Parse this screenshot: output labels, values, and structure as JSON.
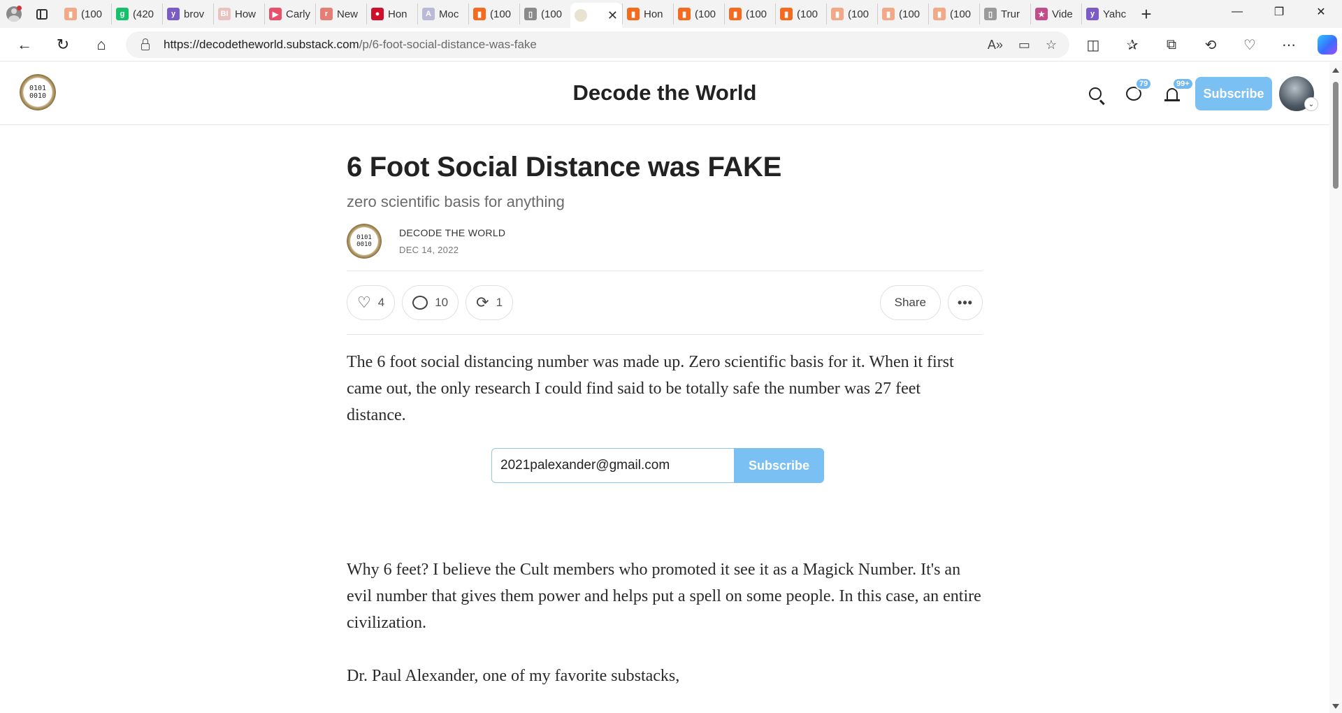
{
  "browser": {
    "tabs": [
      {
        "title": "(100",
        "color": "#f2a988",
        "glyph": "▮"
      },
      {
        "title": "(420",
        "color": "#15c26b",
        "glyph": "g"
      },
      {
        "title": "brov",
        "color": "#7b5cc7",
        "glyph": "y"
      },
      {
        "title": "How",
        "color": "#e8c4c0",
        "glyph": "BI"
      },
      {
        "title": "Carly",
        "color": "#e9506a",
        "glyph": "▶"
      },
      {
        "title": "New",
        "color": "#e57f76",
        "glyph": "r"
      },
      {
        "title": "Hon",
        "color": "#d0102a",
        "glyph": "●"
      },
      {
        "title": "Moc",
        "color": "#b9b9d8",
        "glyph": "A"
      },
      {
        "title": "(100",
        "color": "#f56a1f",
        "glyph": "▮"
      },
      {
        "title": "(100",
        "color": "#8a8a8a",
        "glyph": "▯"
      }
    ],
    "active_tab": {
      "title": "",
      "close": "✕"
    },
    "tabs_after": [
      {
        "title": "Hon",
        "color": "#f56a1f",
        "glyph": "▮"
      },
      {
        "title": "(100",
        "color": "#f56a1f",
        "glyph": "▮"
      },
      {
        "title": "(100",
        "color": "#f56a1f",
        "glyph": "▮"
      },
      {
        "title": "(100",
        "color": "#f56a1f",
        "glyph": "▮"
      },
      {
        "title": "(100",
        "color": "#f2a988",
        "glyph": "▮"
      },
      {
        "title": "(100",
        "color": "#f2a988",
        "glyph": "▮"
      },
      {
        "title": "(100",
        "color": "#f2a988",
        "glyph": "▮"
      },
      {
        "title": "Trur",
        "color": "#9a9a9a",
        "glyph": "▯"
      },
      {
        "title": "Vide",
        "color": "#c24d8a",
        "glyph": "★"
      },
      {
        "title": "Yahc",
        "color": "#7b5cc7",
        "glyph": "y"
      }
    ],
    "url_host": "https://decodetheworld.substack.com",
    "url_path": "/p/6-foot-social-distance-was-fake"
  },
  "site": {
    "title": "Decode the World",
    "logo_text": "0101\n0010",
    "chat_badge": "79",
    "notif_badge": "99+",
    "subscribe_label": "Subscribe"
  },
  "post": {
    "title": "6 Foot Social Distance was FAKE",
    "subtitle": "zero scientific basis for anything",
    "author": "DECODE THE WORLD",
    "date": "DEC 14, 2022",
    "likes": "4",
    "comments": "10",
    "restacks": "1",
    "share_label": "Share",
    "more_label": "•••",
    "paragraph_1": "The 6 foot social distancing number was made up. Zero scientific basis for it. When it first came out, the only research I could find said to be totally safe the number was 27 feet distance.",
    "email_value": "2021palexander@gmail.com",
    "form_subscribe_label": "Subscribe",
    "paragraph_2": "Why 6 feet? I believe the Cult members who promoted it see it as a Magick Number. It's an evil number that gives them power and helps put a spell on some people. In this case, an entire civilization.",
    "paragraph_3": "Dr. Paul Alexander, one of my favorite substacks,"
  },
  "colors": {
    "accent": "#7bc0f3",
    "badge": "#73b9f1",
    "text": "#222222"
  }
}
